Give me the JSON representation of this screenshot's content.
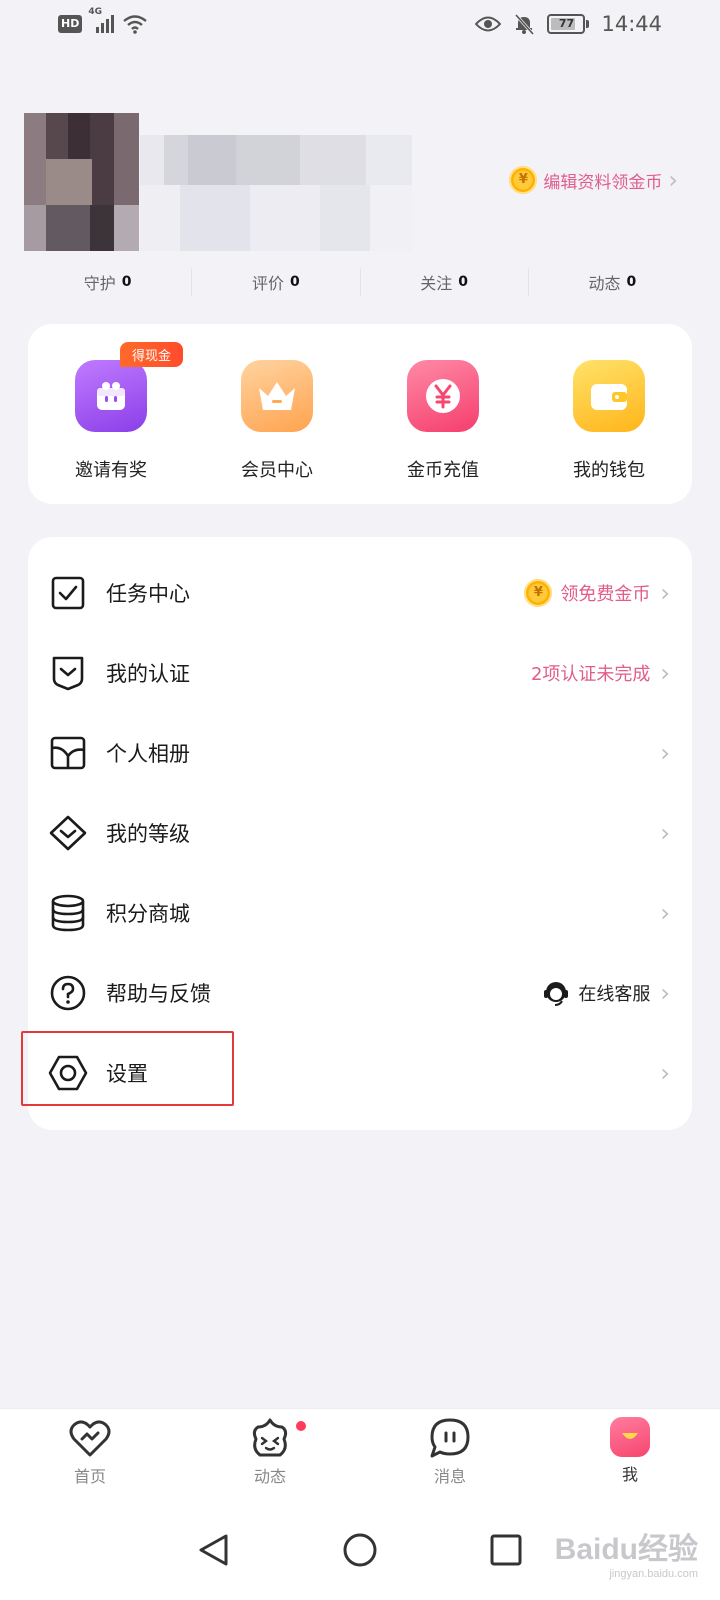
{
  "status_bar": {
    "hd": "HD",
    "network": "4G",
    "battery": "77",
    "time": "14:44"
  },
  "profile": {
    "edit_link": "编辑资料领金币",
    "coin_symbol": "¥",
    "stats": [
      {
        "label": "守护",
        "value": "0"
      },
      {
        "label": "评价",
        "value": "0"
      },
      {
        "label": "关注",
        "value": "0"
      },
      {
        "label": "动态",
        "value": "0"
      }
    ]
  },
  "quick_actions": {
    "badge": "得现金",
    "items": [
      {
        "label": "邀请有奖",
        "icon": "gift-icon"
      },
      {
        "label": "会员中心",
        "icon": "crown-icon"
      },
      {
        "label": "金币充值",
        "icon": "yen-coin-icon"
      },
      {
        "label": "我的钱包",
        "icon": "wallet-icon"
      }
    ]
  },
  "menu": {
    "items": [
      {
        "label": "任务中心",
        "extra": "领免费金币",
        "icon": "checkbox-icon"
      },
      {
        "label": "我的认证",
        "extra": "2项认证未完成",
        "icon": "shield-check-icon"
      },
      {
        "label": "个人相册",
        "extra": "",
        "icon": "album-icon"
      },
      {
        "label": "我的等级",
        "extra": "",
        "icon": "diamond-icon"
      },
      {
        "label": "积分商城",
        "extra": "",
        "icon": "coin-stack-icon"
      },
      {
        "label": "帮助与反馈",
        "extra": "在线客服",
        "icon": "question-icon"
      },
      {
        "label": "设置",
        "extra": "",
        "icon": "hexagon-settings-icon"
      }
    ]
  },
  "bottom_nav": {
    "items": [
      {
        "label": "首页",
        "icon": "heart-home-icon"
      },
      {
        "label": "动态",
        "icon": "star-face-icon"
      },
      {
        "label": "消息",
        "icon": "chat-bubble-icon"
      },
      {
        "label": "我",
        "icon": "me-icon"
      }
    ]
  },
  "watermark": {
    "main": "Baidu经验",
    "sub": "jingyan.baidu.com"
  },
  "colors": {
    "accent_pink": "#e05d8c",
    "badge_orange": "#ff5a2a",
    "highlight_red": "#e23a3a"
  }
}
